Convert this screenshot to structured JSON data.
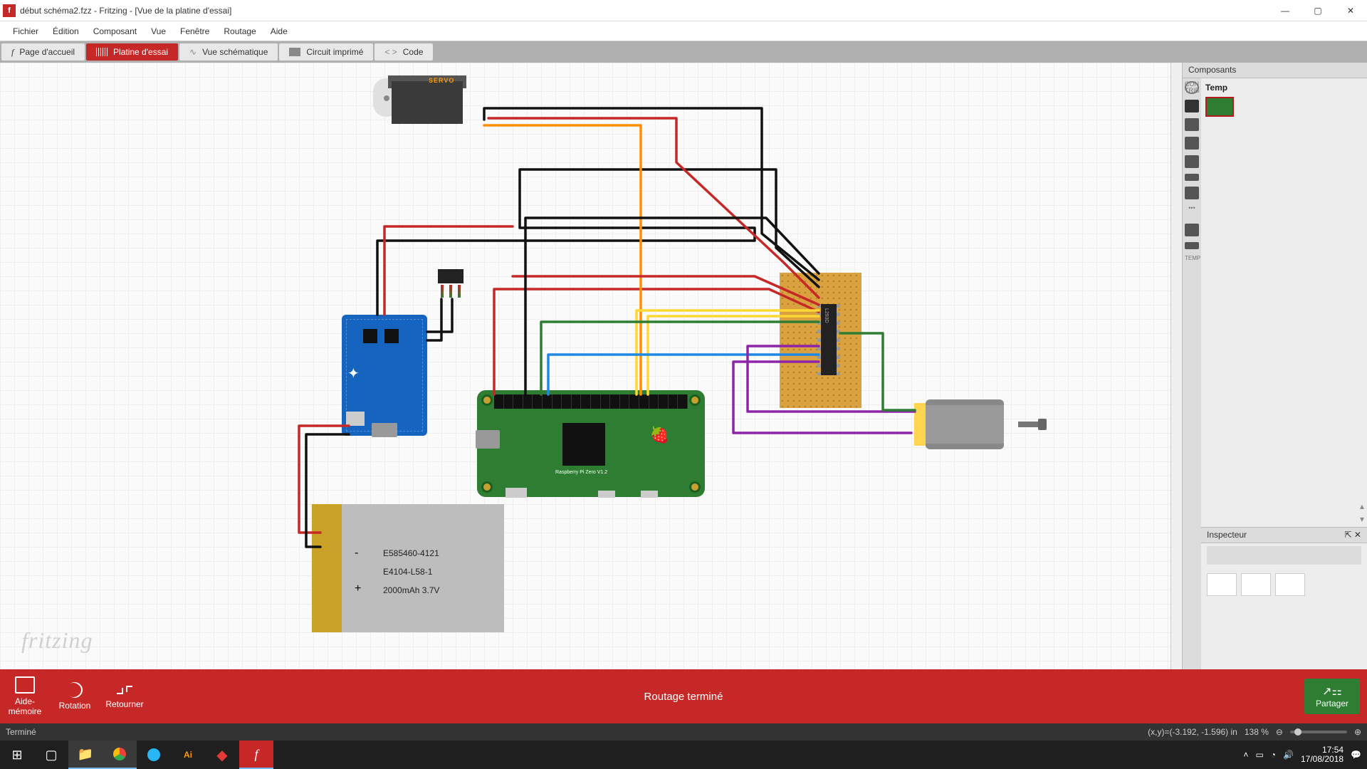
{
  "window": {
    "title": "début schéma2.fzz - Fritzing - [Vue de la platine d'essai]",
    "app_icon_letter": "f"
  },
  "menu": {
    "items": [
      "Fichier",
      "Édition",
      "Composant",
      "Vue",
      "Fenêtre",
      "Routage",
      "Aide"
    ]
  },
  "view_tabs": {
    "home": "Page d'accueil",
    "breadboard": "Platine d'essai",
    "schematic": "Vue schématique",
    "pcb": "Circuit imprimé",
    "code": "Code"
  },
  "canvas": {
    "watermark": "fritzing",
    "servo_label": "SERVO",
    "pi_label": "Raspberry Pi Zero V1.2",
    "ic_label": "L293D",
    "battery": {
      "line1": "E585460-4121",
      "line2": "E4104-L58-1",
      "line3": "2000mAh 3.7V",
      "plus": "+",
      "minus": "-"
    }
  },
  "right_panel": {
    "composants_title": "Composants",
    "bin_label": "Temp",
    "strip_label_temp": "TEMP",
    "strip_label_contrib": "CON\nTRIB",
    "inspector_title": "Inspecteur"
  },
  "bottom_bar": {
    "aide": "Aide-mémoire",
    "rotation": "Rotation",
    "retourner": "Retourner",
    "routing_msg": "Routage terminé",
    "share": "Partager"
  },
  "status_bar": {
    "left": "Terminé",
    "coords": "(x,y)=(-3.192, -1.596) in",
    "zoom": "138 %"
  },
  "taskbar": {
    "time": "17:54",
    "date": "17/08/2018"
  },
  "chart_data": {
    "type": "diagram",
    "note": "Fritzing breadboard wiring diagram",
    "components": [
      {
        "name": "Servo motor",
        "label": "SERVO"
      },
      {
        "name": "Adafruit PowerBoost (blue board)"
      },
      {
        "name": "Slide switch"
      },
      {
        "name": "Raspberry Pi Zero V1.2"
      },
      {
        "name": "Perfboard with L293D motor driver IC"
      },
      {
        "name": "DC motor"
      },
      {
        "name": "LiPo battery",
        "specs": "E585460-4121 / E4104-L58-1 / 2000mAh 3.7V"
      }
    ],
    "wires": [
      {
        "color": "red",
        "from": "Battery +",
        "to": "PowerBoost BAT"
      },
      {
        "color": "black",
        "from": "Battery -",
        "to": "PowerBoost GND"
      },
      {
        "color": "black",
        "from": "PowerBoost GND",
        "to": "Pi GND header"
      },
      {
        "color": "black",
        "from": "PowerBoost",
        "to": "Switch"
      },
      {
        "color": "red",
        "from": "PowerBoost 5V",
        "to": "Pi 5V / L293D Vcc"
      },
      {
        "color": "orange",
        "from": "Servo signal",
        "to": "Pi GPIO"
      },
      {
        "color": "red",
        "from": "Servo V+",
        "to": "5V rail"
      },
      {
        "color": "black",
        "from": "Servo GND",
        "to": "GND rail / L293D GND"
      },
      {
        "color": "black",
        "from": "Pi GND",
        "to": "L293D GND"
      },
      {
        "color": "red",
        "from": "Pi 5V",
        "to": "L293D Vcc2"
      },
      {
        "color": "yellow",
        "from": "Pi GPIO",
        "to": "L293D IN"
      },
      {
        "color": "green",
        "from": "Pi GPIO",
        "to": "L293D IN / Motor"
      },
      {
        "color": "blue",
        "from": "Pi GPIO",
        "to": "L293D EN"
      },
      {
        "color": "purple",
        "from": "L293D OUT",
        "to": "Motor terminal"
      },
      {
        "color": "green",
        "from": "L293D OUT",
        "to": "Motor terminal"
      }
    ]
  }
}
